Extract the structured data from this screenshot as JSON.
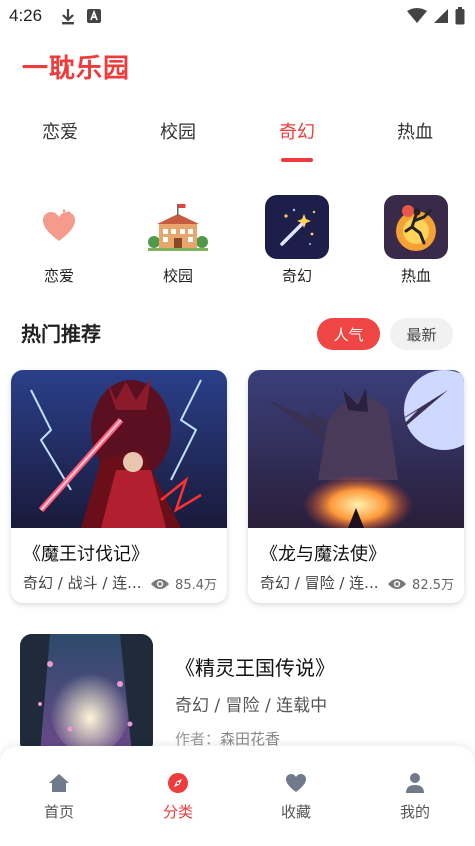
{
  "status": {
    "time": "4:26"
  },
  "app": {
    "title": "一耽乐园"
  },
  "tabs": [
    {
      "label": "恋爱"
    },
    {
      "label": "校园"
    },
    {
      "label": "奇幻"
    },
    {
      "label": "热血"
    }
  ],
  "categories": [
    {
      "label": "恋爱",
      "icon": "heart-icon"
    },
    {
      "label": "校园",
      "icon": "school-building-icon"
    },
    {
      "label": "奇幻",
      "icon": "magic-wand-icon"
    },
    {
      "label": "热血",
      "icon": "fighter-icon"
    }
  ],
  "hot": {
    "title": "热门推荐",
    "filters": {
      "popular": "人气",
      "latest": "最新"
    },
    "books": [
      {
        "title": "《魔王讨伐记》",
        "tags": "奇幻 / 战斗 / 连...",
        "views": "85.4万"
      },
      {
        "title": "《龙与魔法使》",
        "tags": "奇幻 / 冒险 / 连...",
        "views": "82.5万"
      }
    ]
  },
  "featured": {
    "title": "《精灵王国传说》",
    "tags": "奇幻 / 冒险 / 连载中",
    "author_label": "作者：",
    "author": "森田花香"
  },
  "nav": [
    {
      "label": "首页",
      "icon": "home-icon"
    },
    {
      "label": "分类",
      "icon": "compass-icon"
    },
    {
      "label": "收藏",
      "icon": "heart-icon"
    },
    {
      "label": "我的",
      "icon": "user-icon"
    }
  ],
  "colors": {
    "accent": "#ee3b3b",
    "chip_inactive": "#f1f1f1"
  }
}
